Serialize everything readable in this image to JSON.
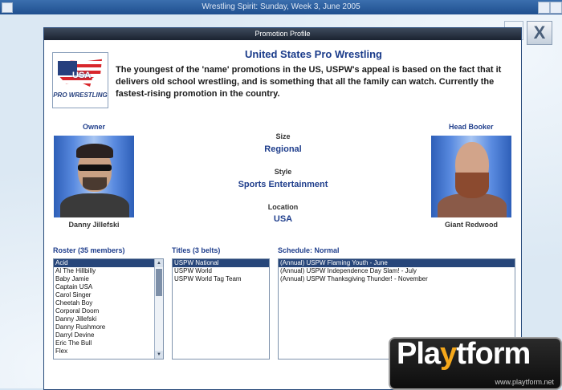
{
  "window_title": "Wrestling Spirit: Sunday, Week 3, June 2005",
  "panel": {
    "title": "Promotion Profile",
    "close_label": "X"
  },
  "promotion": {
    "name": "United States Pro Wrestling",
    "logo_text": "USA",
    "logo_subtitle": "PRO WRESTLING",
    "description": "The youngest of the 'name' promotions in the US, USPW's appeal is based on the fact that it delivers old school wrestling, and is something that all the family can watch. Currently the fastest-rising promotion in the country."
  },
  "owner": {
    "heading": "Owner",
    "name": "Danny Jillefski"
  },
  "booker": {
    "heading": "Head Booker",
    "name": "Giant Redwood"
  },
  "details": {
    "size_label": "Size",
    "size_value": "Regional",
    "style_label": "Style",
    "style_value": "Sports Entertainment",
    "location_label": "Location",
    "location_value": "USA"
  },
  "roster": {
    "heading": "Roster (35 members)",
    "items": [
      "Acid",
      "Al The Hillbilly",
      "Baby Jamie",
      "Captain USA",
      "Carol Singer",
      "Cheetah Boy",
      "Corporal Doom",
      "Danny Jillefski",
      "Danny Rushmore",
      "Darryl Devine",
      "Eric The Bull",
      "Flex"
    ]
  },
  "titles": {
    "heading": "Titles (3 belts)",
    "items": [
      "USPW National",
      "USPW World",
      "USPW World Tag Team"
    ]
  },
  "schedule": {
    "heading": "Schedule: Normal",
    "items": [
      "(Annual) USPW Flaming Youth - June",
      "(Annual) USPW Independence Day Slam! - July",
      "(Annual) USPW Thanksgiving Thunder! - November"
    ]
  },
  "watermark": {
    "prefix": "Pla",
    "accent": "y",
    "suffix": "tform",
    "url": "www.playtform.net"
  }
}
